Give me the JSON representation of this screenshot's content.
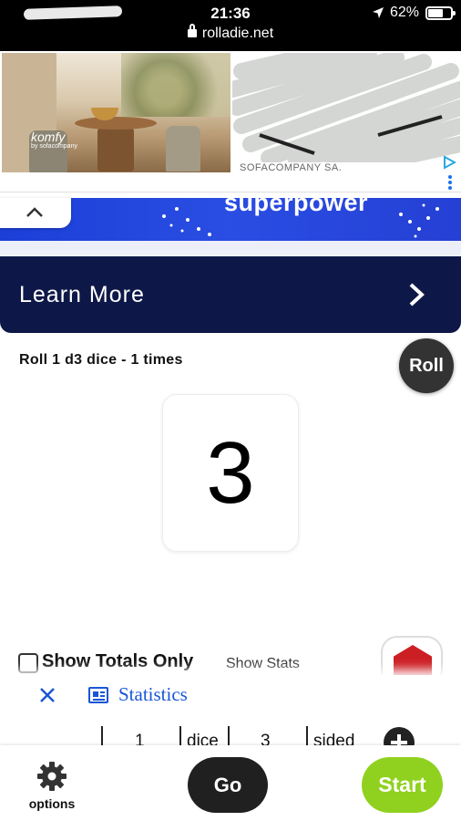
{
  "status_bar": {
    "time": "21:36",
    "url": "rolladie.net",
    "battery": "62%"
  },
  "ad": {
    "logo": "komfy",
    "logo_sub": "by sofacompany",
    "brand": "SOFACOMPANY SA.",
    "strip_text": "superpower"
  },
  "learn_more": {
    "label": "Learn More"
  },
  "roll": {
    "title": "Roll 1 d3 dice - 1 times",
    "button_label": "Roll",
    "result": "3"
  },
  "controls": {
    "totals_label": "Show Totals Only",
    "stats_label": "Show Stats"
  },
  "statistics": {
    "title": "Statistics"
  },
  "settings_row": {
    "dice_count": "1",
    "dice_label": "dice",
    "sides": "3",
    "sides_label": "sided"
  },
  "toolbar": {
    "options_label": "options",
    "go_label": "Go",
    "start_label": "Start"
  },
  "colors": {
    "start": "#8fd11e",
    "learn_more_bg": "#0e1848",
    "statistics_link": "#1a56d6"
  }
}
